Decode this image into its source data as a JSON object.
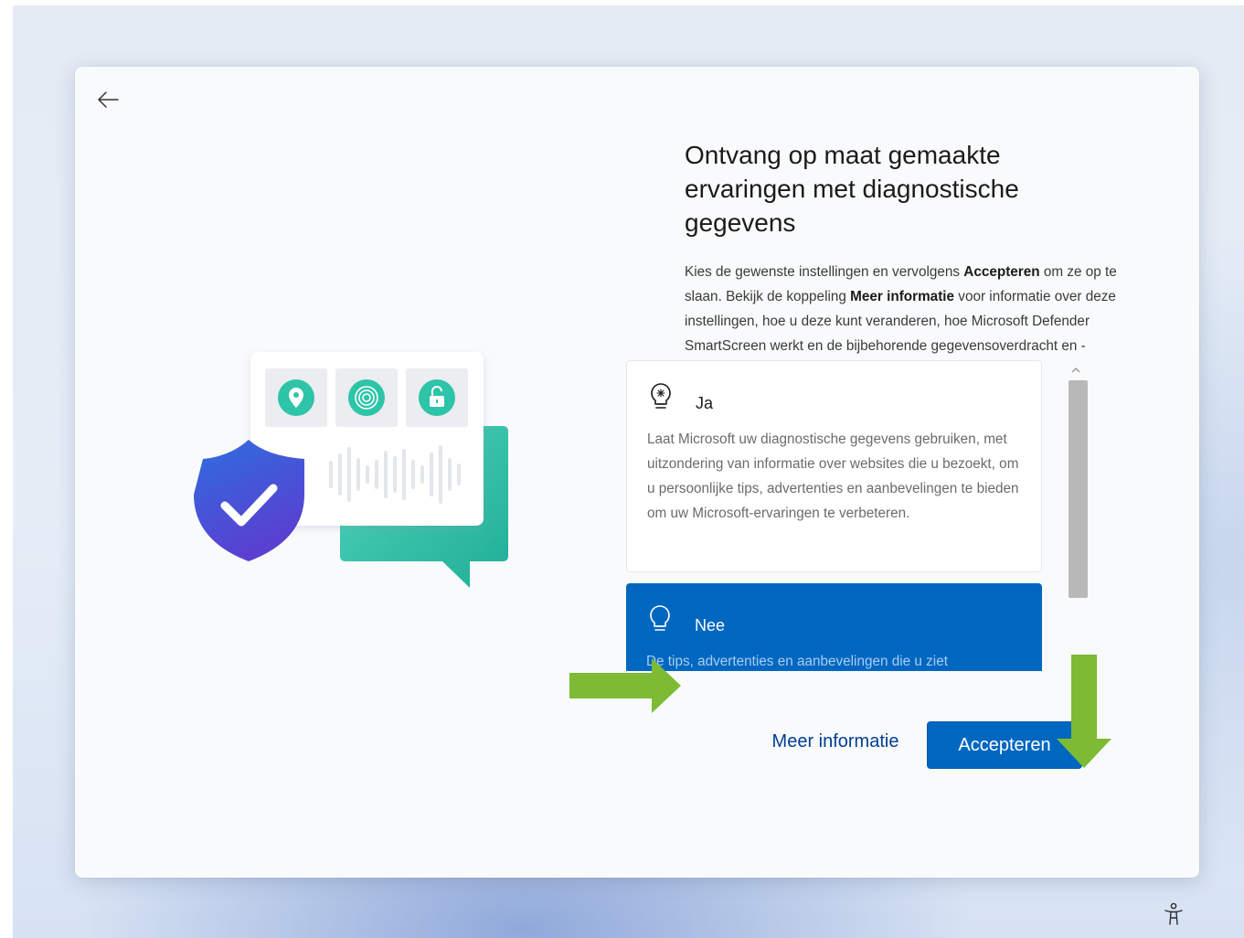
{
  "page": {
    "heading": "Ontvang op maat gemaakte ervaringen met diagnostische gegevens",
    "description": {
      "p1": "Kies de gewenste instellingen en vervolgens ",
      "b1": "Accepteren",
      "p2": " om ze op te slaan. Bekijk de koppeling ",
      "b2": "Meer informatie",
      "p3": " voor informatie over deze instellingen, hoe u deze kunt veranderen, hoe Microsoft Defender SmartScreen werkt en de bijbehorende gegevensoverdracht en -toepassingen."
    }
  },
  "options": [
    {
      "title": "Ja",
      "description": "Laat Microsoft uw diagnostische gegevens gebruiken, met uitzondering van informatie over websites die u bezoekt, om u persoonlijke tips, advertenties en aanbevelingen te bieden om uw Microsoft-ervaringen te verbeteren.",
      "selected": false,
      "icon": "lightbulb-sparkle-icon"
    },
    {
      "title": "Nee",
      "description": "De tips, advertenties en aanbevelingen die u ziet",
      "selected": true,
      "icon": "lightbulb-icon"
    }
  ],
  "buttons": {
    "more_info": "Meer informatie",
    "accept": "Accepteren"
  },
  "icons": {
    "back": "back-arrow-icon",
    "accessibility": "accessibility-icon",
    "illustration": [
      "location-pin-icon",
      "fingerprint-icon",
      "unlock-icon",
      "shield-check-icon",
      "chat-bubble-icon"
    ]
  },
  "colors": {
    "accent": "#0067c0",
    "annotation_arrow": "#7cbb33",
    "illustration_teal": "#2fbfa5",
    "shield_blue": "#3f58d9"
  }
}
